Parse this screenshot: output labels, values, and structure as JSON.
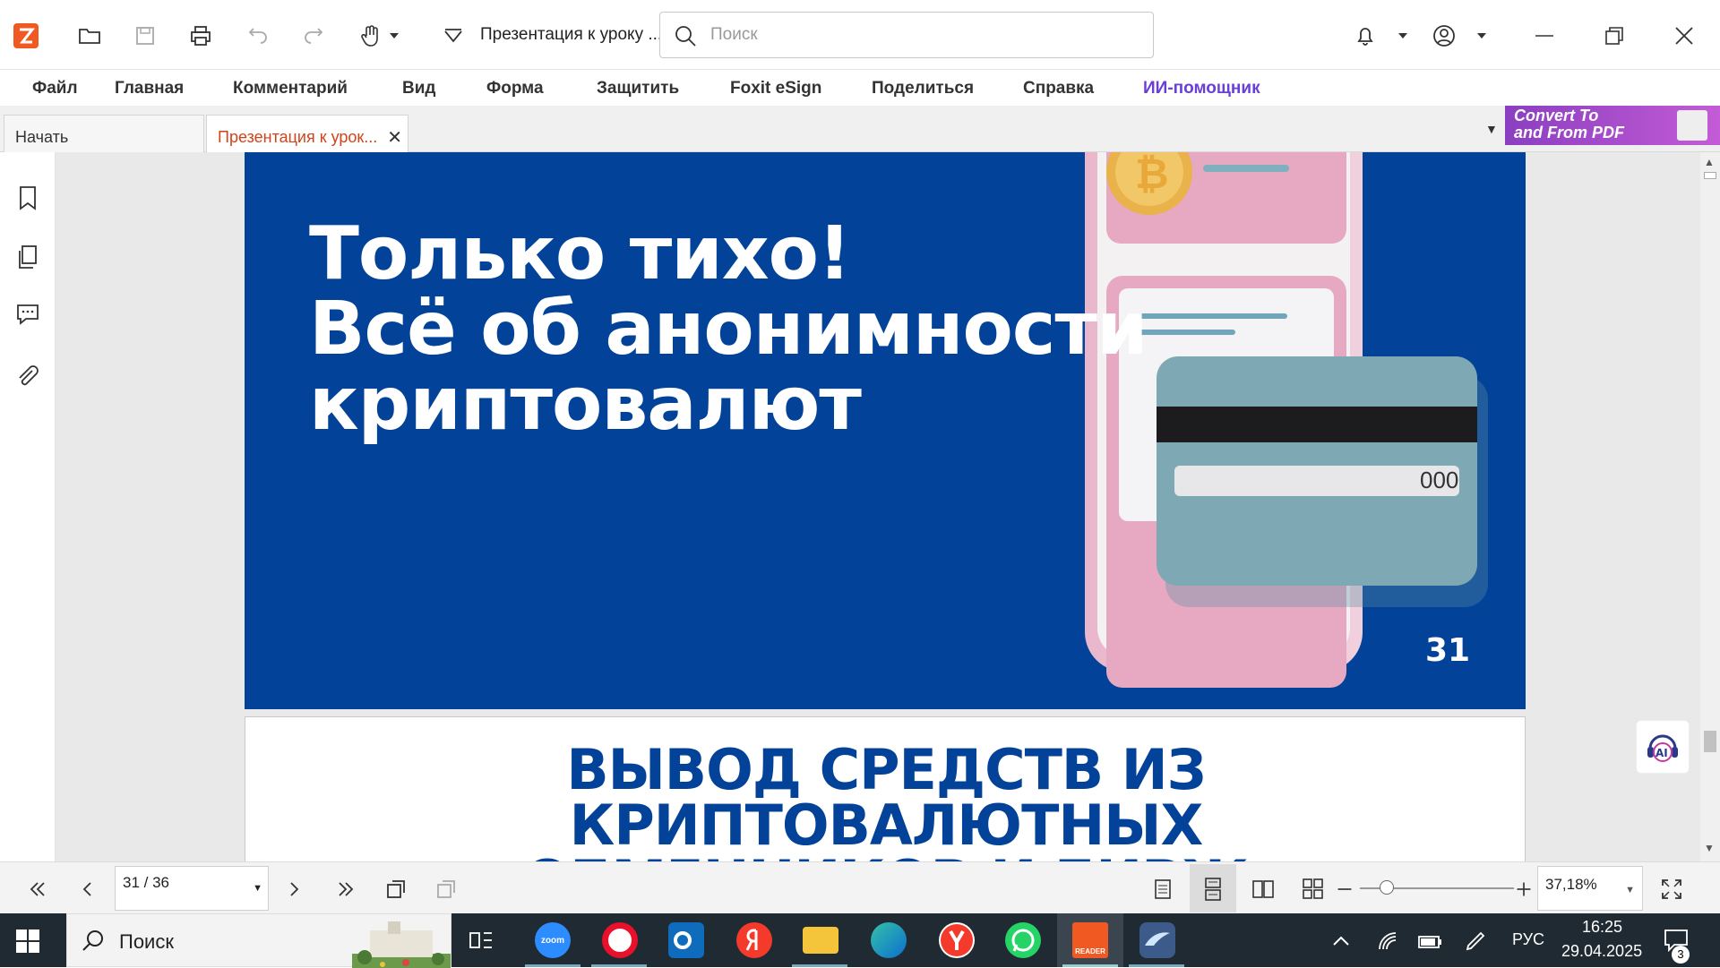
{
  "titlebar": {
    "doc_title": "Презентация к уроку ...",
    "search_placeholder": "Поиск"
  },
  "ribbon": {
    "items": [
      "Файл",
      "Главная",
      "Комментарий",
      "Вид",
      "Форма",
      "Защитить",
      "Foxit eSign",
      "Поделиться",
      "Справка",
      "ИИ-помощник"
    ]
  },
  "tabs": {
    "start": "Начать",
    "document": "Презентация к урок...",
    "close_glyph": "✕",
    "convert_line1": "Convert To",
    "convert_line2": "and From PDF"
  },
  "slide31": {
    "title_lines": [
      "Только тихо!",
      "Всё об анонимности",
      "криптовалют"
    ],
    "card_number": "000",
    "page_number": "31"
  },
  "slide32": {
    "title_lines": [
      "ВЫВОД СРЕДСТВ ИЗ КРИПТОВАЛЮТНЫХ",
      "ОБМЕННИКОВ И БИРЖ"
    ]
  },
  "statusbar": {
    "page": "31 / 36",
    "zoom": "37,18%"
  },
  "taskbar": {
    "search_label": "Поиск",
    "language": "РУС",
    "time": "16:25",
    "date": "29.04.2025",
    "notification_count": "3",
    "zoom_app_label": "zoom",
    "reader_label": "READER"
  },
  "colors": {
    "slide_bg": "#024399",
    "accent_ai": "#6a3ed8",
    "tab_active_text": "#d2431a",
    "foxit_orange": "#f05a22"
  },
  "icons": [
    "app-logo-icon",
    "open-folder-icon",
    "save-icon",
    "print-icon",
    "undo-icon",
    "redo-icon",
    "hand-tool-icon",
    "quick-access-icon",
    "search-icon",
    "bell-icon",
    "account-icon",
    "minimize-icon",
    "restore-icon",
    "close-icon",
    "bookmark-icon",
    "pages-icon",
    "comments-icon",
    "attachment-icon",
    "ai-assistant-icon"
  ]
}
